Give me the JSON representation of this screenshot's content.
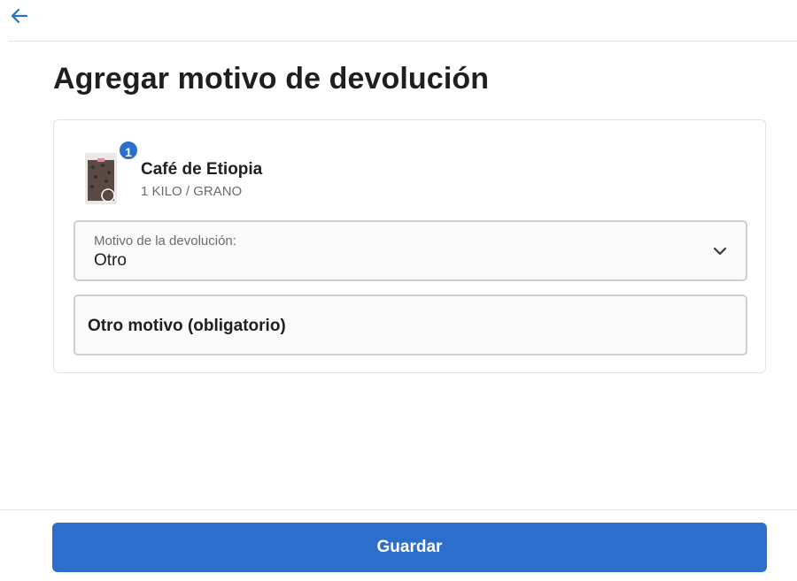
{
  "header": {
    "back_icon": "arrow-left-icon",
    "title": "Agregar motivo de devolución"
  },
  "product": {
    "quantity": "1",
    "name": "Café de Etiopia",
    "variant": "1 KILO / GRANO"
  },
  "return_reason": {
    "label": "Motivo de la devolución:",
    "value": "Otro",
    "icon": "chevron-down-icon"
  },
  "other_reason": {
    "placeholder": "Otro motivo (obligatorio)",
    "value": ""
  },
  "footer": {
    "save_label": "Guardar"
  },
  "colors": {
    "accent": "#2c6ecb",
    "text": "#1f1f1f",
    "muted": "#6b6b6b",
    "border": "#cfcfcf"
  }
}
